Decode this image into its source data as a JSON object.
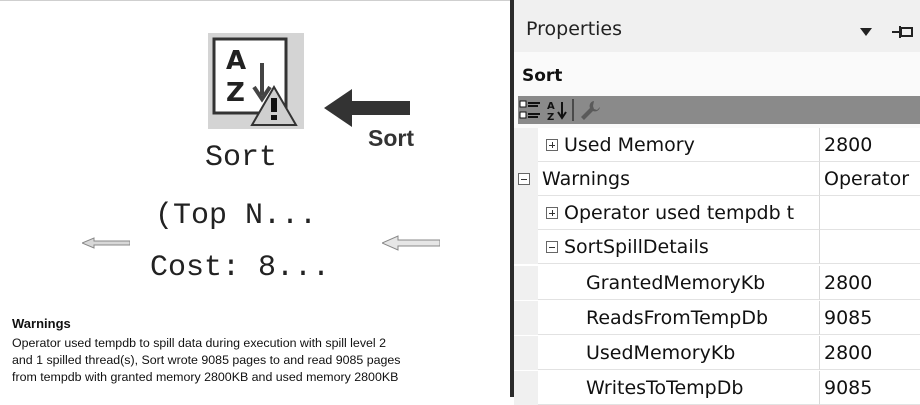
{
  "plan": {
    "node_name": "Sort",
    "node_detail": "(Top N...",
    "node_cost": "Cost: 8...",
    "callout_label": "Sort",
    "icon_letters": [
      "A",
      "Z"
    ]
  },
  "warnings_panel": {
    "title": "Warnings",
    "lines": [
      "Operator used tempdb to spill data during execution with spill level 2",
      "and 1 spilled thread(s), Sort wrote 9085 pages to and read 9085 pages",
      "from tempdb with granted memory 2800KB and used memory 2800KB"
    ]
  },
  "properties": {
    "title": "Properties",
    "object": "Sort",
    "toolbar": [
      "categorized-icon",
      "alphabetical-icon",
      "wrench-icon"
    ],
    "rows": [
      {
        "expander": "plus",
        "name": "Used Memory",
        "value": "2800"
      },
      {
        "expander": "minus",
        "name": "Warnings",
        "value": "Operator"
      },
      {
        "expander": "plus",
        "name": "Operator used tempdb t",
        "value": ""
      },
      {
        "expander": "minus",
        "name": "SortSpillDetails",
        "value": ""
      },
      {
        "expander": "",
        "name": "GrantedMemoryKb",
        "value": "2800"
      },
      {
        "expander": "",
        "name": "ReadsFromTempDb",
        "value": "9085"
      },
      {
        "expander": "",
        "name": "UsedMemoryKb",
        "value": "2800"
      },
      {
        "expander": "",
        "name": "WritesToTempDb",
        "value": "9085"
      }
    ]
  }
}
